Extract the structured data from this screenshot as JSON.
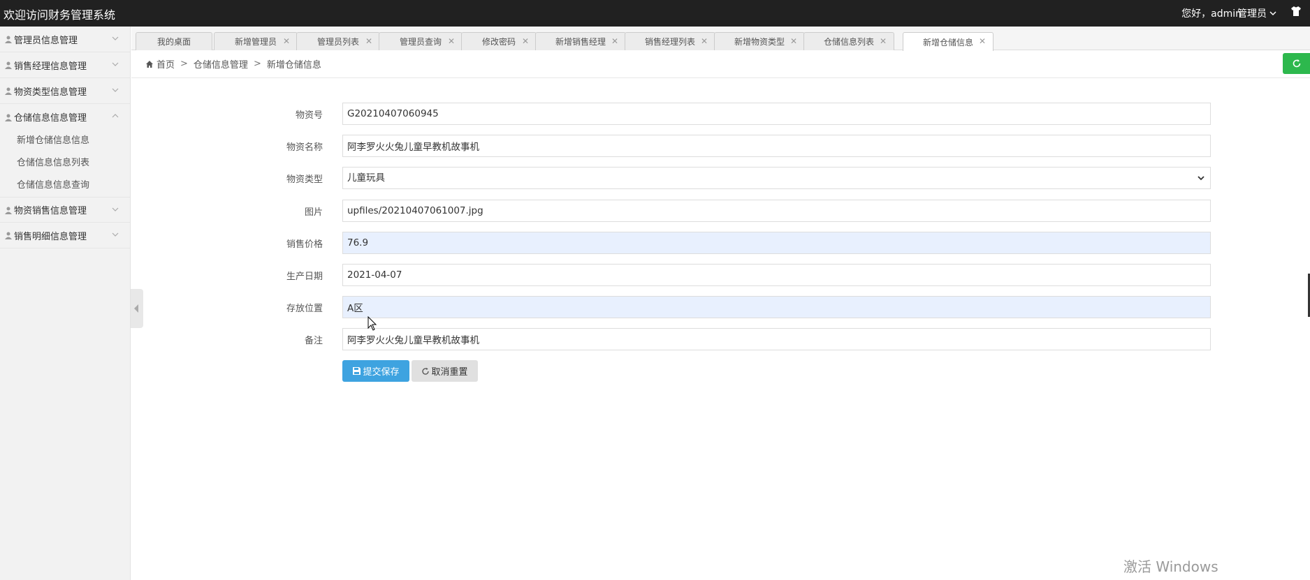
{
  "topbar": {
    "title": "欢迎访问财务管理系统",
    "greeting": "您好，admin",
    "role": "管理员"
  },
  "sidebar": {
    "groups": [
      {
        "label": "管理员信息管理"
      },
      {
        "label": "销售经理信息管理"
      },
      {
        "label": "物资类型信息管理"
      },
      {
        "label": "仓储信息信息管理",
        "expanded": true,
        "items": [
          "新增仓储信息信息",
          "仓储信息信息列表",
          "仓储信息信息查询"
        ]
      },
      {
        "label": "物资销售信息管理"
      },
      {
        "label": "销售明细信息管理"
      }
    ]
  },
  "tabs": [
    "我的桌面",
    "新增管理员",
    "管理员列表",
    "管理员查询",
    "修改密码",
    "新增销售经理",
    "销售经理列表",
    "新增物资类型",
    "仓储信息列表",
    "新增仓储信息"
  ],
  "active_tab": "新增仓储信息",
  "breadcrumb": {
    "home": "首页",
    "section": "仓储信息管理",
    "current": "新增仓储信息"
  },
  "form": {
    "material_no": {
      "label": "物资号",
      "value": "G20210407060945"
    },
    "material_name": {
      "label": "物资名称",
      "value": "阿李罗火火兔儿童早教机故事机"
    },
    "material_type": {
      "label": "物资类型",
      "value": "儿童玩具"
    },
    "image": {
      "label": "图片",
      "value": "upfiles/20210407061007.jpg"
    },
    "price": {
      "label": "销售价格",
      "value": "76.9"
    },
    "production_date": {
      "label": "生产日期",
      "value": "2021-04-07"
    },
    "location": {
      "label": "存放位置",
      "value": "A区"
    },
    "remark": {
      "label": "备注",
      "value": "阿李罗火火兔儿童早教机故事机"
    }
  },
  "buttons": {
    "save": "提交保存",
    "reset": "取消重置"
  },
  "watermark": "激活 Windows",
  "colors": {
    "topbar": "#212121",
    "save_button": "#3ea3e0",
    "refresh_button": "#2db84d",
    "autofill_highlight": "#e8f0fe"
  }
}
